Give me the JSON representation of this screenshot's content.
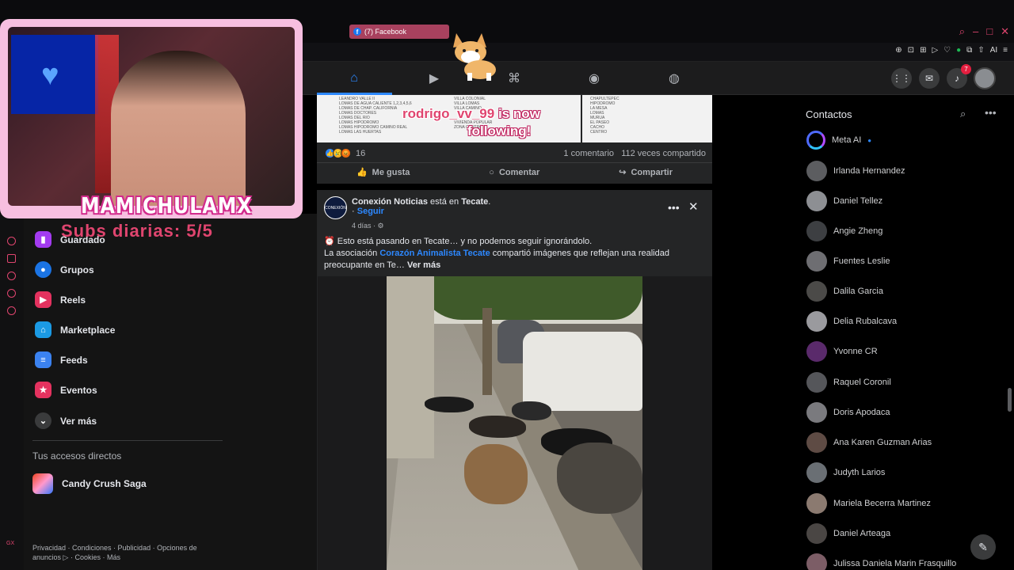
{
  "browser": {
    "tab_title": "(7) Facebook",
    "window_controls": [
      "⌕",
      "–",
      "□",
      "✕"
    ],
    "ext_icons": [
      "⊕",
      "⊡",
      "⊞",
      "▷",
      "♡",
      "●",
      "⧉",
      "⇧",
      "AI",
      "≡"
    ]
  },
  "stream": {
    "streamer_name": "MAMICHULAMX",
    "subs_label": "Subs diarias: 5/5",
    "follow_user": "rodrigo_vv_99",
    "follow_suffix": "is now",
    "follow_word": "following!"
  },
  "nav": {
    "notif_count": "7",
    "tabs": [
      "home-icon",
      "video-icon",
      "marketplace-icon",
      "groups-icon",
      "gaming-icon"
    ]
  },
  "sidebar": {
    "items": [
      {
        "label": "Guardado",
        "icon": "bookmark-icon",
        "color": "#a33bf0"
      },
      {
        "label": "Grupos",
        "icon": "groups-icon",
        "color": "#1b74e4"
      },
      {
        "label": "Reels",
        "icon": "reels-icon",
        "color": "#e4325f"
      },
      {
        "label": "Marketplace",
        "icon": "marketplace-icon",
        "color": "#1b9ae4"
      },
      {
        "label": "Feeds",
        "icon": "feeds-icon",
        "color": "#3b82f0"
      },
      {
        "label": "Eventos",
        "icon": "events-icon",
        "color": "#e4325f"
      },
      {
        "label": "Ver más",
        "icon": "chevron-down-icon",
        "color": "#3a3b3c"
      }
    ],
    "shortcuts_title": "Tus accesos directos",
    "shortcut": "Candy Crush Saga",
    "footer": "Privacidad · Condiciones · Publicidad · Opciones de anuncios ▷ · Cookies · Más",
    "rail_label": "GX"
  },
  "post1": {
    "reaction_count": "16",
    "comments": "1 comentario",
    "shares": "112 veces compartido",
    "like": "Me gusta",
    "comment": "Comentar",
    "share": "Compartir",
    "strip_col1": "LEANDRO VALLE II\nLOMAS DE AGUA CALIENTE 1,2,3,4,5,6\nLOMAS DE CHAP. CALIFORNIA\nLOMAS DOCTORES\nLOMAS DEL RIO\nLOMAS HIPODROMO\nLOMAS HIPODROMO CAMINO REAL\nLOMAS LAS HUERTAS",
    "strip_col2": "VILLA COLONIAL\nVILLA LOMAS\nVILLA CAMINO\n\n\nVIVIENDA POPULAR\nZONA CENTRO",
    "strip_col3": "CHAPULTEPEC\nHIPODROMO\nLA MESA\nLOMAS\nMURUA\nEL PASEO\nCACHO\nCENTRO"
  },
  "post2": {
    "page_name": "Conexión Noticias",
    "in_text": "está en",
    "location": "Tecate",
    "follow": "Seguir",
    "time": "4 días · ⚙",
    "line1": "Esto está pasando en Tecate… y no podemos seguir ignorándolo.",
    "line2_pre": "La asociación",
    "line2_link": "Corazón Animalista Tecate",
    "line2_post": "compartió imágenes que reflejan una realidad preocupante en Te…",
    "see_more": "Ver más",
    "avatar_text": "CONEXIÓN"
  },
  "contacts": {
    "title": "Contactos",
    "list": [
      "Meta AI",
      "Irlanda Hernandez",
      "Daniel Tellez",
      "Angie Zheng",
      "Fuentes Leslie",
      "Dalila Garcia",
      "Delia Rubalcava",
      "Yvonne CR",
      "Raquel Coronil",
      "Doris Apodaca",
      "Ana Karen Guzman Arias",
      "Judyth Larios",
      "Mariela Becerra Martinez",
      "Daniel Arteaga",
      "Julissa Daniela Marin Frasquillo"
    ]
  }
}
